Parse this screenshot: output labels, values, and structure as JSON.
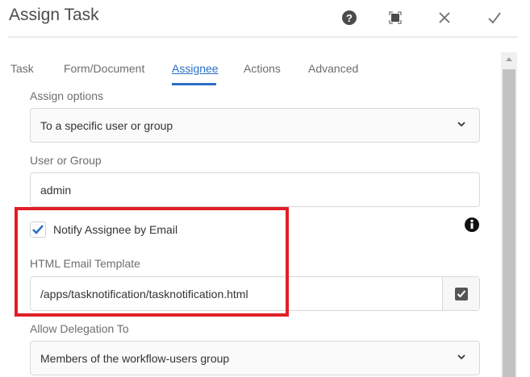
{
  "dialog": {
    "title": "Assign Task"
  },
  "header_icons": [
    "help-icon",
    "fullscreen-icon",
    "close-icon",
    "checkmark-icon"
  ],
  "tabs": [
    {
      "label": "Task"
    },
    {
      "label": "Form/Document"
    },
    {
      "label": "Assignee",
      "active": true
    },
    {
      "label": "Actions"
    },
    {
      "label": "Advanced"
    }
  ],
  "form": {
    "assign_options": {
      "label": "Assign options",
      "value": "To a specific user or group"
    },
    "user_or_group": {
      "label": "User or Group",
      "value": "admin"
    },
    "notify": {
      "label": "Notify Assignee by Email",
      "checked": true
    },
    "email_template": {
      "label": "HTML Email Template",
      "value": "/apps/tasknotification/tasknotification.html"
    },
    "delegation": {
      "label": "Allow Delegation To",
      "value": "Members of the workflow-users group"
    }
  },
  "colors": {
    "accent": "#2b6ec7",
    "highlight": "#e01f26"
  }
}
